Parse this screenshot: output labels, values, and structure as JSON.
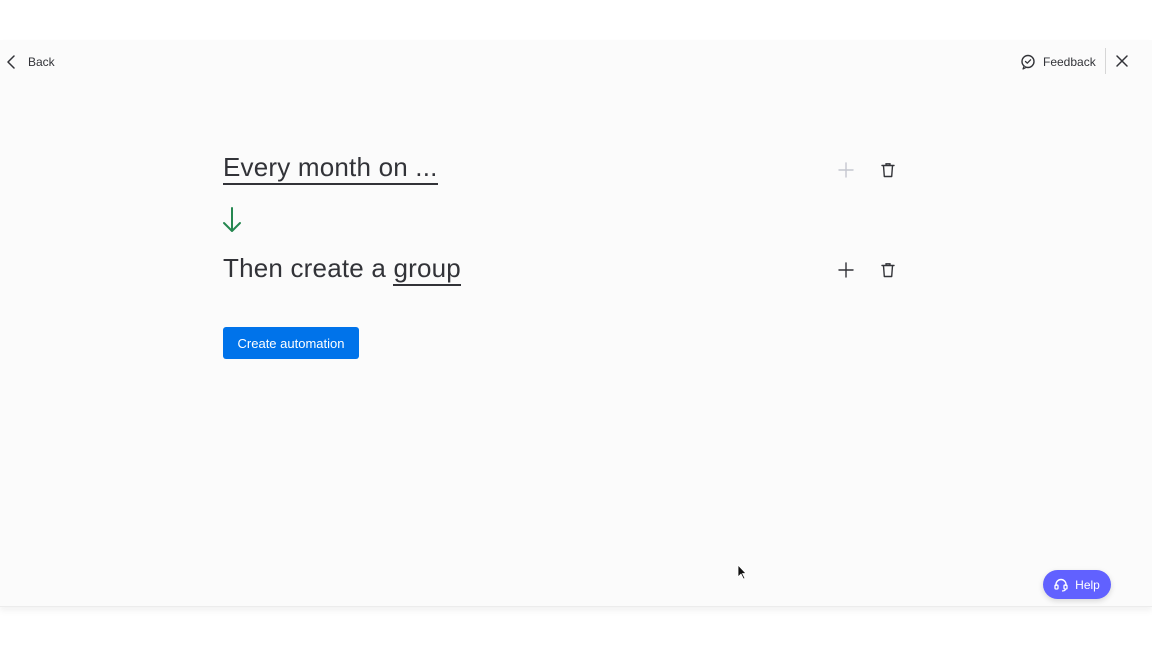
{
  "header": {
    "back_label": "Back",
    "feedback_label": "Feedback"
  },
  "recipe": {
    "trigger_text": "Every month on ...",
    "action_prefix": "Then create a",
    "action_object": "group"
  },
  "create_button_label": "Create automation",
  "help_label": "Help",
  "colors": {
    "primary": "#0073ea",
    "help": "#6161ff",
    "arrow": "#258750",
    "text": "#323338"
  },
  "icons": {
    "back": "chevron-left-icon",
    "feedback": "speech-bubble-icon",
    "close": "close-icon",
    "arrow": "arrow-down-icon",
    "add": "plus-icon",
    "delete": "trash-icon",
    "help": "headset-icon"
  }
}
